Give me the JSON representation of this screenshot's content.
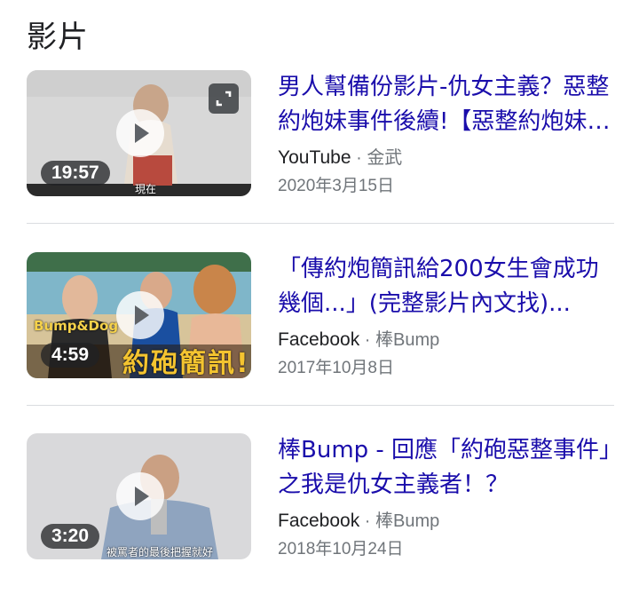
{
  "section": {
    "title": "影片"
  },
  "videos": [
    {
      "title": "男人幫備份影片-仇女主義？惡整約炮妹事件後續!【惡整約炮妹事件】",
      "source": "YouTube",
      "channel": "金武",
      "date": "2020年3月15日",
      "duration": "19:57",
      "caption": "現在",
      "expand_icon": "expand-icon"
    },
    {
      "title": "「傳約炮簡訊給200女生會成功幾個...」(完整影片內文找)...",
      "source": "Facebook",
      "channel": "棒Bump",
      "date": "2017年10月8日",
      "duration": "4:59",
      "overlay_text": "Bump&Dog",
      "banner_text": "約砲簡訊!"
    },
    {
      "title": "棒Bump - 回應「約砲惡整事件」之我是仇女主義者！？",
      "source": "Facebook",
      "channel": "棒Bump",
      "date": "2018年10月24日",
      "duration": "3:20",
      "caption": "被罵者的最後把握就好"
    }
  ],
  "separator": " · "
}
